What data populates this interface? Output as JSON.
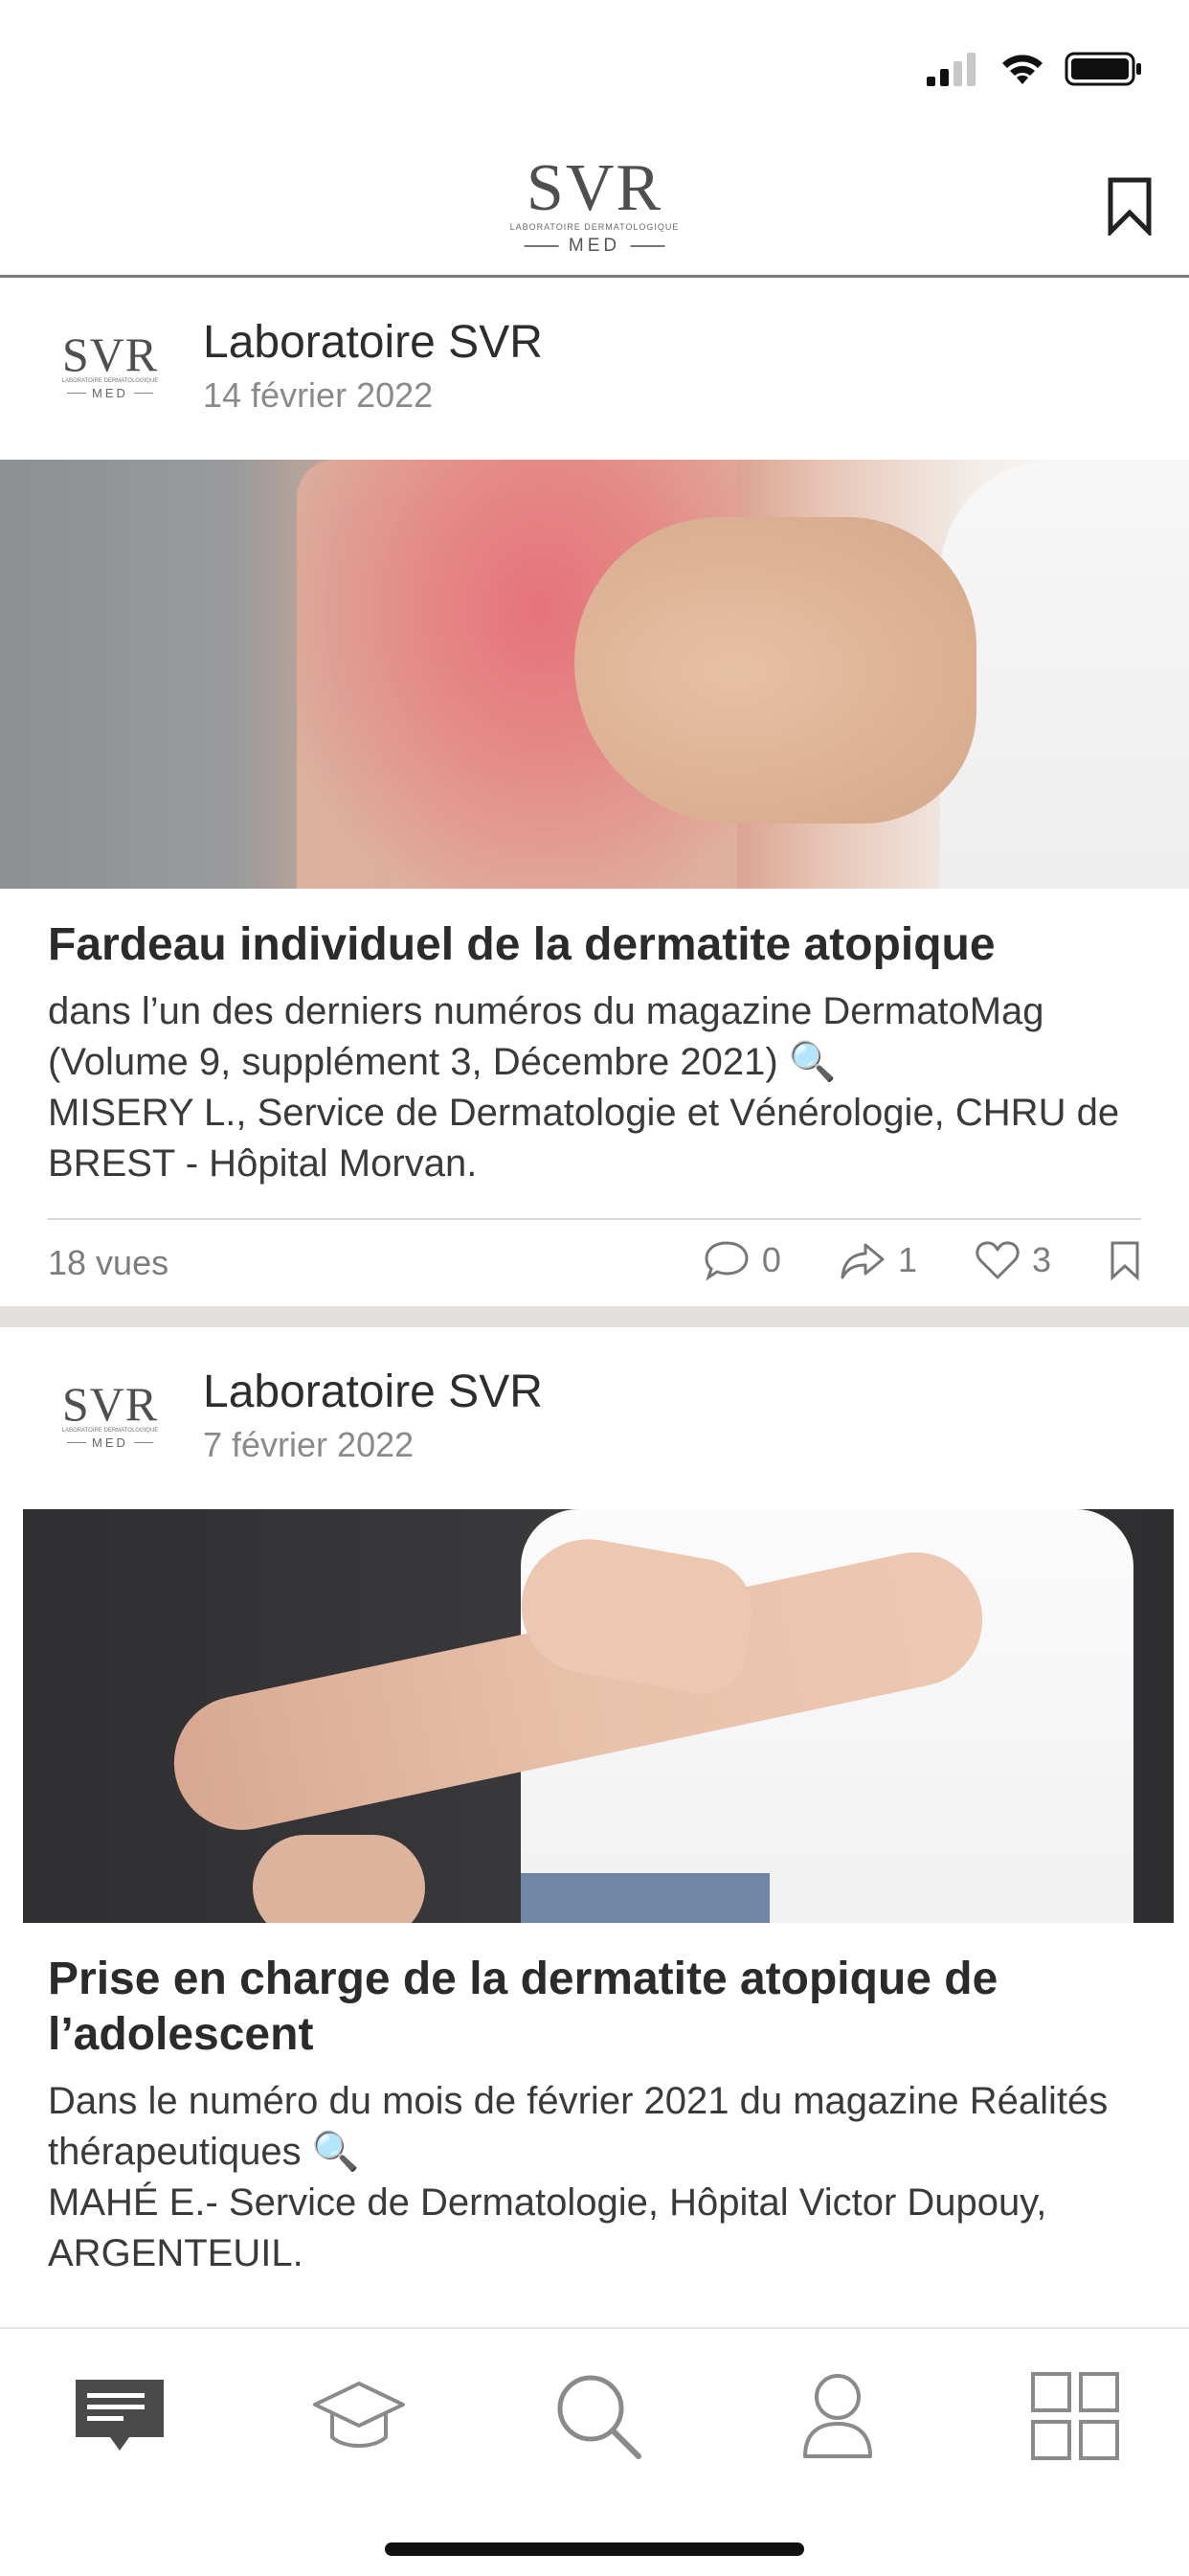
{
  "header": {
    "logo_text": "SVR",
    "logo_sub": "LABORATOIRE DERMATOLOGIQUE",
    "logo_med": "MED"
  },
  "posts": [
    {
      "author": "Laboratoire SVR",
      "date": "14 février 2022",
      "title": "Fardeau individuel de la dermatite atopique",
      "excerpt": "dans l’un des derniers numéros du magazine DermatoMag (Volume 9, supplément 3, Décembre 2021) 🔍\nMISERY L., Service de Dermatologie et Vénérologie, CHRU de BREST - Hôpital Morvan.",
      "views": "18 vues",
      "comments": "0",
      "shares": "1",
      "likes": "3"
    },
    {
      "author": "Laboratoire SVR",
      "date": "7 février 2022",
      "title": "Prise en charge de la dermatite atopique de l’adolescent",
      "excerpt": "Dans le numéro du mois de février 2021 du magazine Réalités thérapeutiques 🔍\nMAHÉ E.- Service de Dermatologie, Hôpital Victor Dupouy, ARGENTEUIL."
    }
  ],
  "tabbar": {
    "items": [
      "feed-icon",
      "graduation-cap-icon",
      "search-icon",
      "profile-icon",
      "grid-icon"
    ]
  }
}
